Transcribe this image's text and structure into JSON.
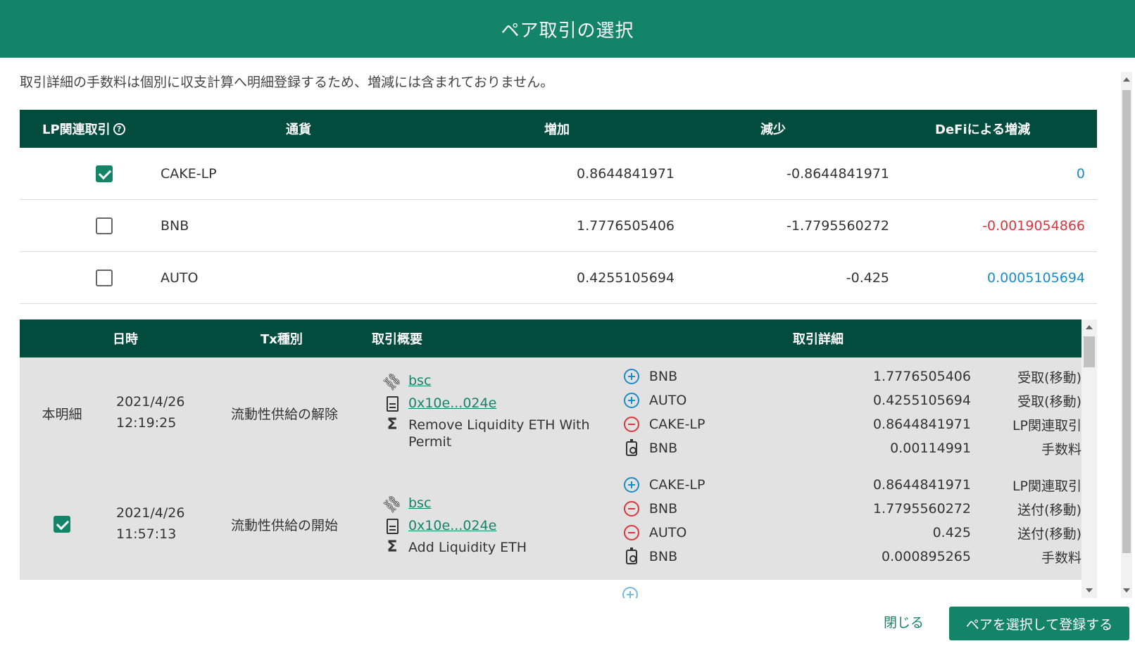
{
  "dialog": {
    "title": "ペア取引の選択",
    "notice": "取引詳細の手数料は個別に収支計算へ明細登録するため、増減には含まれておりません。"
  },
  "summary_table": {
    "headers": {
      "lp": "LP関連取引",
      "currency": "通貨",
      "increase": "増加",
      "decrease": "減少",
      "defi": "DeFiによる増減"
    },
    "rows": [
      {
        "checked": true,
        "currency": "CAKE-LP",
        "increase": "0.8644841971",
        "decrease": "-0.8644841971",
        "defi": "0",
        "defi_sign": "pos"
      },
      {
        "checked": false,
        "currency": "BNB",
        "increase": "1.7776505406",
        "decrease": "-1.7795560272",
        "defi": "-0.0019054866",
        "defi_sign": "neg"
      },
      {
        "checked": false,
        "currency": "AUTO",
        "increase": "0.4255105694",
        "decrease": "-0.425",
        "defi": "0.0005105694",
        "defi_sign": "pos"
      }
    ]
  },
  "detail_table": {
    "headers": {
      "datetime": "日時",
      "tx_type": "Tx種別",
      "summary": "取引概要",
      "detail": "取引詳細"
    },
    "rows": [
      {
        "label": "本明細",
        "date": "2021/4/26",
        "time": "12:19:25",
        "tx_type": "流動性供給の解除",
        "chain": "bsc",
        "tx_hash": "0x10e...024e",
        "method_line1": "Remove Liquidity ETH With",
        "method_line2": "Permit",
        "details": [
          {
            "icon": "plus",
            "currency": "BNB",
            "amount": "1.7776505406",
            "kind": "受取(移動)"
          },
          {
            "icon": "plus",
            "currency": "AUTO",
            "amount": "0.4255105694",
            "kind": "受取(移動)"
          },
          {
            "icon": "minus",
            "currency": "CAKE-LP",
            "amount": "0.8644841971",
            "kind": "LP関連取引"
          },
          {
            "icon": "fee",
            "currency": "BNB",
            "amount": "0.00114991",
            "kind": "手数料"
          }
        ]
      },
      {
        "label": "",
        "checked": true,
        "date": "2021/4/26",
        "time": "11:57:13",
        "tx_type": "流動性供給の開始",
        "chain": "bsc",
        "tx_hash": "0x10e...024e",
        "method_line1": "Add Liquidity ETH",
        "details": [
          {
            "icon": "plus",
            "currency": "CAKE-LP",
            "amount": "0.8644841971",
            "kind": "LP関連取引"
          },
          {
            "icon": "minus",
            "currency": "BNB",
            "amount": "1.7795560272",
            "kind": "送付(移動)"
          },
          {
            "icon": "minus",
            "currency": "AUTO",
            "amount": "0.425",
            "kind": "送付(移動)"
          },
          {
            "icon": "fee",
            "currency": "BNB",
            "amount": "0.000895265",
            "kind": "手数料"
          }
        ]
      }
    ]
  },
  "footer": {
    "close_label": "閉じる",
    "submit_label": "ペアを選択して登録する"
  },
  "colors": {
    "header_bg": "#138468",
    "table_head_bg": "#024c3e",
    "positive": "#1a8cc8",
    "negative": "#d9363e"
  }
}
